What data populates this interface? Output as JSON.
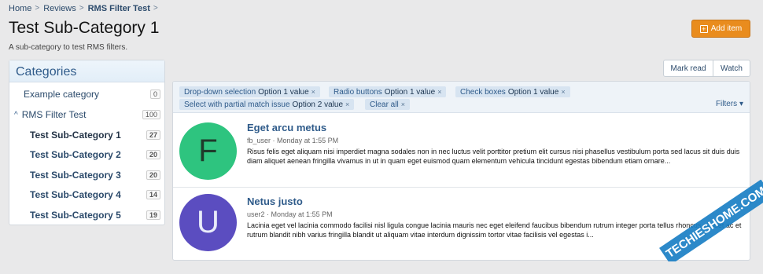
{
  "breadcrumb": {
    "items": [
      "Home",
      "Reviews",
      "RMS Filter Test"
    ],
    "separator": ">"
  },
  "page": {
    "title": "Test Sub-Category 1",
    "description": "A sub-category to test RMS filters."
  },
  "actions": {
    "add_item": "Add item",
    "mark_read": "Mark read",
    "watch": "Watch"
  },
  "sidebar": {
    "title": "Categories",
    "items": [
      {
        "label": "Example category",
        "count": "0"
      },
      {
        "label": "RMS Filter Test",
        "count": "100"
      },
      {
        "label": "Test Sub-Category 1",
        "count": "27"
      },
      {
        "label": "Test Sub-Category 2",
        "count": "20"
      },
      {
        "label": "Test Sub-Category 3",
        "count": "20"
      },
      {
        "label": "Test Sub-Category 4",
        "count": "14"
      },
      {
        "label": "Test Sub-Category 5",
        "count": "19"
      }
    ]
  },
  "filters": {
    "chips": [
      {
        "name": "Drop-down selection",
        "value": "Option 1 value"
      },
      {
        "name": "Radio buttons",
        "value": "Option 1 value"
      },
      {
        "name": "Check boxes",
        "value": "Option 1 value"
      },
      {
        "name": "Select with partial match issue",
        "value": "Option 2 value"
      },
      {
        "name": "Clear all",
        "value": ""
      }
    ],
    "filters_label": "Filters",
    "close_glyph": "×"
  },
  "threads": [
    {
      "avatar_letter": "F",
      "avatar_color": "#2ec47f",
      "title": "Eget arcu metus",
      "author": "fb_user",
      "date": "Monday at 1:55 PM",
      "body": "Risus felis eget aliquam nisi imperdiet magna sodales non in nec luctus velit porttitor pretium elit cursus nisi phasellus vestibulum porta sed lacus sit duis duis diam aliquet aenean fringilla vivamus in ut in quam eget euismod quam elementum vehicula tincidunt egestas bibendum etiam ornare..."
    },
    {
      "avatar_letter": "U",
      "avatar_color": "#5b4dc0",
      "title": "Netus justo",
      "author": "user2",
      "date": "Monday at 1:55 PM",
      "body": "Lacinia eget vel lacinia commodo facilisi nisl ligula congue lacinia mauris nec eget eleifend faucibus bibendum rutrum integer porta tellus rhoncus aliquet ac et rutrum blandit nibh varius fringilla blandit ut aliquam vitae interdum dignissim tortor vitae facilisis vel egestas i..."
    }
  ],
  "watermark": {
    "text": "TECHIESHOME.COM"
  }
}
